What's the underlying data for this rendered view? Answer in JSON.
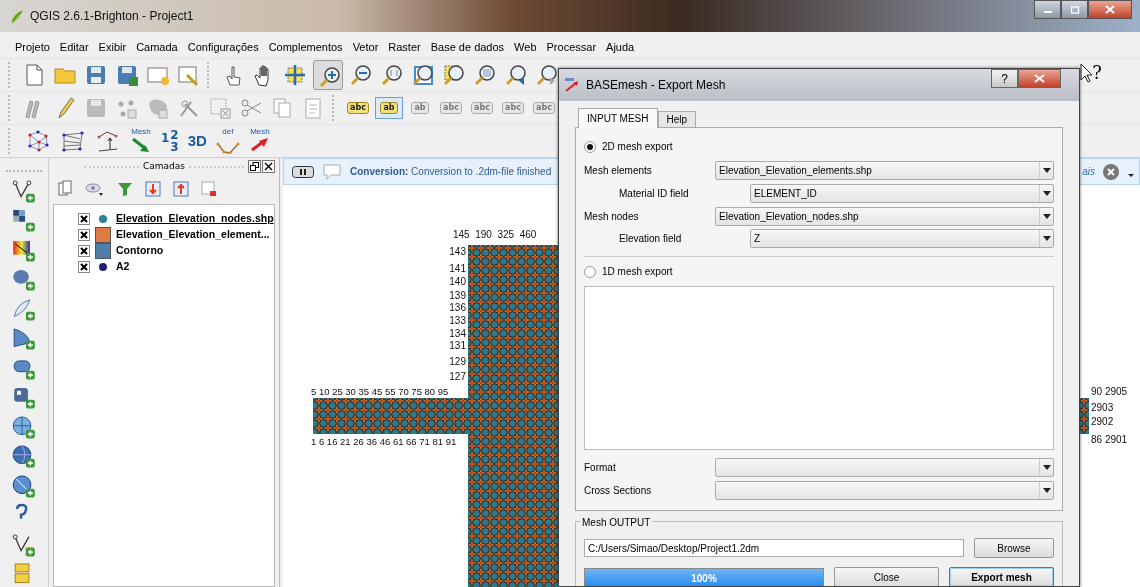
{
  "window": {
    "title": "QGIS 2.6.1-Brighton - Project1"
  },
  "menu": [
    "Projeto",
    "Editar",
    "Exibir",
    "Camada",
    "Configurações",
    "Complementos",
    "Vetor",
    "Raster",
    "Base de dados",
    "Web",
    "Processar",
    "Ajuda"
  ],
  "toolbar": {
    "zoom_in_active": true,
    "whats_this": "?"
  },
  "label_toolbar": [
    {
      "text": "abc",
      "active": false
    },
    {
      "text": "ab",
      "active": true
    },
    {
      "text": "ab",
      "active": false
    },
    {
      "text": "abc",
      "active": false
    },
    {
      "text": "abc",
      "active": false
    },
    {
      "text": "abc",
      "active": false
    },
    {
      "text": "abc",
      "active": false
    }
  ],
  "mesh_toolbar": {
    "import_label": "Mesh",
    "numbering": [
      "1",
      "2",
      "3"
    ],
    "view_3d": "3D",
    "def_label": "def",
    "export_label": "Mesh"
  },
  "layers_panel": {
    "title": "Camadas",
    "layers": [
      {
        "name": "Elevation_Elevation_nodes.shp",
        "checked": true,
        "current": true,
        "kind": "point",
        "color": "#2b7f98"
      },
      {
        "name": "Elevation_Elevation_element...",
        "checked": true,
        "current": false,
        "kind": "fill",
        "color": "#df7a45"
      },
      {
        "name": "Contorno",
        "checked": true,
        "current": false,
        "kind": "fill",
        "color": "#4f7fa8"
      },
      {
        "name": "A2",
        "checked": true,
        "current": false,
        "kind": "point",
        "color": "#1e1e78"
      }
    ]
  },
  "message_bar": {
    "text": "**Conversion:** Conversion to .2dm-file finished",
    "link": "ais"
  },
  "map": {
    "labels": [
      "145  190  325  460",
      "143",
      "141",
      "140",
      "139",
      "136",
      "133",
      "134",
      "131",
      "129",
      "127",
      "5 10 25 30 35 45 55 70 75 80 95",
      "1 6 16 21 26 36 46 61 66 71 81 91",
      "90 2905",
      "2903",
      "2902",
      "86 2901"
    ]
  },
  "dialog": {
    "title": "BASEmesh - Export Mesh",
    "help_button": "?",
    "tabs": [
      {
        "label": "INPUT MESH",
        "selected": true
      },
      {
        "label": "Help",
        "selected": false
      }
    ],
    "export_modes": [
      {
        "label": "2D mesh export",
        "selected": true,
        "fields": [
          {
            "label": "Mesh elements",
            "value": "Elevation_Elevation_elements.shp",
            "children": [
              {
                "label": "Material ID field",
                "value": "ELEMENT_ID"
              }
            ]
          },
          {
            "label": "Mesh nodes",
            "value": "Elevation_Elevation_nodes.shp",
            "children": [
              {
                "label": "Elevation field",
                "value": "Z"
              }
            ]
          }
        ]
      },
      {
        "label": "1D mesh export",
        "selected": false
      }
    ],
    "extra_fields": [
      {
        "label": "Format"
      },
      {
        "label": "Cross Sections"
      }
    ],
    "output": {
      "title": "Mesh OUTPUT",
      "path": "C:/Users/Simao/Desktop/Project1.2dm",
      "browse": "Browse",
      "progress": {
        "level": 1,
        "reading": "100%"
      },
      "buttons": [
        {
          "label": "Close",
          "default": false
        },
        {
          "label": "Export mesh",
          "default": true
        }
      ]
    }
  }
}
